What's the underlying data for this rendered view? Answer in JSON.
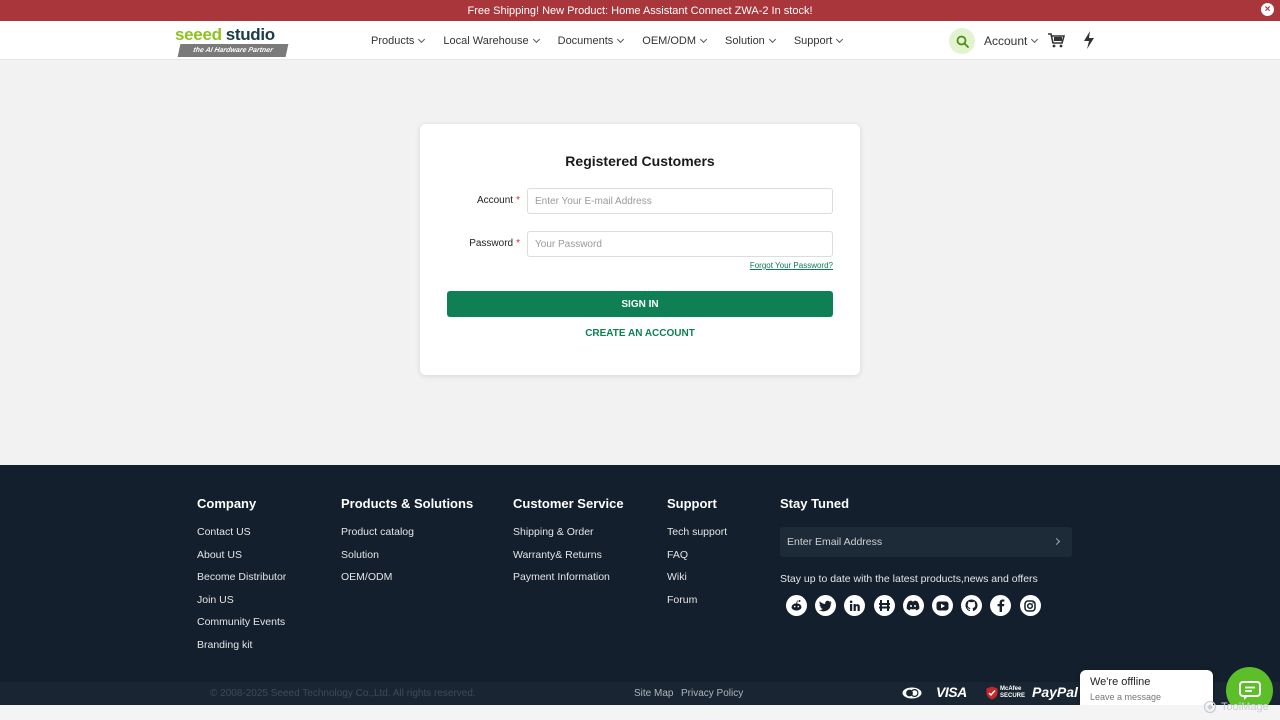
{
  "announcement": {
    "text": "Free Shipping! New Product: Home Assistant Connect ZWA-2 In stock!"
  },
  "logo": {
    "word_green": "seeed",
    "word_dark": "studio",
    "tagline": "the AI Hardware Partner"
  },
  "nav": [
    {
      "label": "Products"
    },
    {
      "label": "Local Warehouse"
    },
    {
      "label": "Documents"
    },
    {
      "label": "OEM/ODM"
    },
    {
      "label": "Solution"
    },
    {
      "label": "Support"
    }
  ],
  "header": {
    "account_label": "Account",
    "accent_color": "#8dc21f"
  },
  "login": {
    "title": "Registered Customers",
    "account_label": "Account",
    "account_placeholder": "Enter Your E-mail Address",
    "password_label": "Password",
    "password_placeholder": "Your Password",
    "required_mark": "*",
    "forgot": "Forgot Your Password?",
    "signin": "SIGN IN",
    "create": "CREATE AN ACCOUNT",
    "primary_color": "#0f8055"
  },
  "footer": {
    "columns": [
      {
        "title": "Company",
        "links": [
          "Contact US",
          "About US",
          "Become Distributor",
          "Join US",
          "Community Events",
          "Branding kit"
        ]
      },
      {
        "title": "Products & Solutions",
        "links": [
          "Product catalog",
          "Solution",
          "OEM/ODM"
        ]
      },
      {
        "title": "Customer Service",
        "links": [
          "Shipping & Order",
          "Warranty& Returns",
          "Payment Information"
        ]
      },
      {
        "title": "Support",
        "links": [
          "Tech support",
          "FAQ",
          "Wiki",
          "Forum"
        ]
      }
    ],
    "stay_tuned": {
      "title": "Stay Tuned",
      "email_placeholder": "Enter Email Address",
      "text": "Stay up to date with the latest products,news and offers"
    },
    "socials": [
      "reddit-icon",
      "twitter-icon",
      "linkedin-icon",
      "hackster-icon",
      "discord-icon",
      "youtube-icon",
      "github-icon",
      "facebook-icon",
      "instagram-icon"
    ],
    "copyright": "© 2008-2025 Seeed Technology Co.,Ltd. All rights reserved.",
    "site_map": "Site Map",
    "privacy": "Privacy Policy",
    "payments": {
      "visa": "VISA",
      "mcafee": "McAfee SECURE",
      "paypal": "PayPal"
    },
    "background_color": "#131f2c"
  },
  "chat": {
    "status": "We're offline",
    "sub": "Leave a message",
    "color": "#5cbf2a"
  },
  "watermark": "ToolMage"
}
